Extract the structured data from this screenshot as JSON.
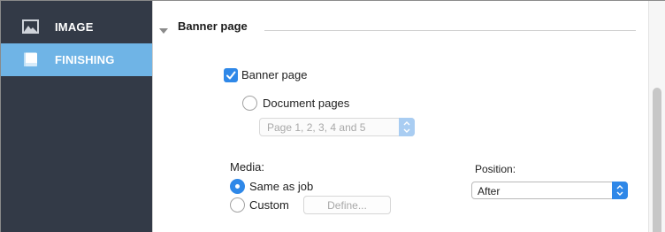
{
  "sidebar": {
    "items": [
      {
        "label": "IMAGE",
        "icon": "image-icon",
        "active": false
      },
      {
        "label": "FINISHING",
        "icon": "book-icon",
        "active": true
      }
    ]
  },
  "section": {
    "title": "Banner page",
    "expanded": true
  },
  "banner_checkbox": {
    "label": "Banner page",
    "checked": true
  },
  "document_pages": {
    "label": "Document pages",
    "selected": false,
    "select_value": "Page 1, 2, 3, 4 and 5"
  },
  "media": {
    "label": "Media:",
    "options": [
      {
        "label": "Same as job",
        "selected": true
      },
      {
        "label": "Custom",
        "selected": false
      }
    ],
    "define_button": "Define..."
  },
  "position": {
    "label": "Position:",
    "value": "After"
  },
  "colors": {
    "sidebar_bg": "#333a47",
    "sidebar_active": "#6fb4e6",
    "accent": "#2f88e8"
  }
}
